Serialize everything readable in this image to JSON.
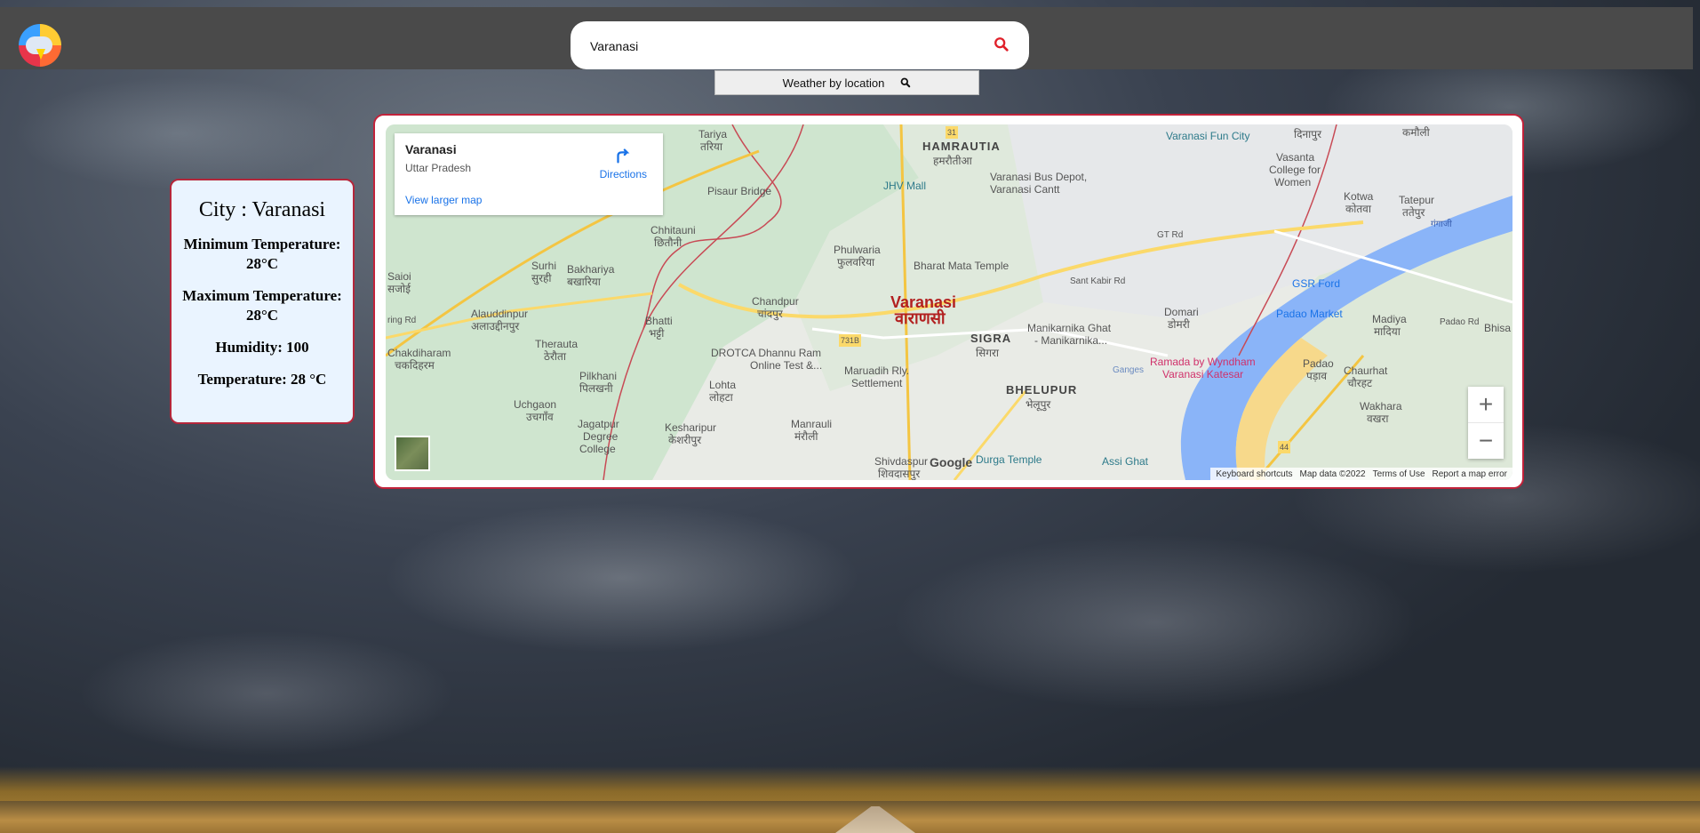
{
  "header": {
    "logo_icon": "weather-logo-icon",
    "search_value": "Varanasi",
    "search_icon": "search-icon",
    "location_button_label": "Weather by location"
  },
  "weather_card": {
    "city_line": "City : Varanasi",
    "min_temp_label": "Minimum Temperature:",
    "min_temp_value": "28°C",
    "max_temp_label": "Maximum Temperature:",
    "max_temp_value": "28°C",
    "humidity_line": "Humidity: 100",
    "temperature_line": "Temperature: 28 °C"
  },
  "map": {
    "place_name": "Varanasi",
    "place_region": "Uttar Pradesh",
    "directions_label": "Directions",
    "larger_map_link": "View larger map",
    "zoom_in": "+",
    "zoom_out": "−",
    "google_logo": "Google",
    "footer": [
      "Keyboard shortcuts",
      "Map data ©2022",
      "Terms of Use",
      "Report a map error"
    ],
    "labels": {
      "varanasi_en": "Varanasi",
      "varanasi_hi": "वाराणसी",
      "hamrautia": "HAMRAUTIA",
      "hamrautia_hi": "हमरौतीआ",
      "sigra": "SIGRA",
      "sigra_hi": "सिगरा",
      "bhelupur": "BHELUPUR",
      "bhelupur_hi": "भेलूपुर",
      "jhv_mall": "JHV Mall",
      "bus_depot": "Varanasi Bus Depot,",
      "bus_depot2": "Varanasi Cantt",
      "fun_city": "Varanasi Fun City",
      "bharat_mata": "Bharat Mata Temple",
      "pisaur": "Pisaur Bridge",
      "chandpur": "Chandpur",
      "chandpur_hi": "चांदपुर",
      "chhitauni": "Chhitauni",
      "chhitauni_hi": "छितौनी",
      "phulwaria": "Phulwaria",
      "phulwaria_hi": "फुलवरिया",
      "surhi": "Surhi",
      "surhi_hi": "सुरही",
      "bakhariya": "Bakhariya",
      "bakhariya_hi": "बखारिया",
      "saioi": "Saioi",
      "saioi_hi": "सजोई",
      "alauddinpur": "Alauddinpur",
      "alauddinpur_hi": "अलाउद्दीनपुर",
      "bhatti": "Bhatti",
      "bhatti_hi": "भट्टी",
      "therauta": "Therauta",
      "therauta_hi": "ठेरौता",
      "chakdiharam": "Chakdiharam",
      "chakdiharam_hi": "चकदिहरम",
      "pilkhani": "Pilkhani",
      "pilkhani_hi": "पिलखनी",
      "uchgaon": "Uchgaon",
      "uchgaon_hi": "उचगाँव",
      "lohta": "Lohta",
      "lohta_hi": "लोहटा",
      "dhannu": "DROTCA Dhannu Ram",
      "dhannu2": "Online Test &...",
      "maruadih": "Maruadih Rly.",
      "maruadih2": "Settlement",
      "manrauli": "Manrauli",
      "manrauli_hi": "मंरौली",
      "keshripur": "Kesharipur",
      "keshripur_hi": "केशरीपुर",
      "jagatpur": "Jagatpur",
      "jagatpur2": "Degree",
      "jagatpur3": "College",
      "shivdaspur": "Shivdaspur",
      "shivdaspur_hi": "शिवदासपुर",
      "durga": "Durga Temple",
      "assi": "Assi Ghat",
      "manikarnika": "Manikarnika Ghat",
      "manikarnika2": "- Manikarnika...",
      "ramada": "Ramada by Wyndham",
      "ramada2": "Varanasi Katesar",
      "domari": "Domari",
      "domari_hi": "डोमरी",
      "padao_market": "Padao Market",
      "padao": "Padao",
      "padao_hi": "पड़ाव",
      "gsr_ford": "GSR Ford",
      "madiya": "Madiya",
      "madiya_hi": "मादिया",
      "chaurhat": "Chaurhat",
      "chaurhat_hi": "चौरहट",
      "wakhara": "Wakhara",
      "wakhara_hi": "वखरा",
      "tatepur": "Tatepur",
      "tatepur_hi": "ततेपुर",
      "kotwa": "Kotwa",
      "kotwa_hi": "कोतवा",
      "vasanta": "Vasanta",
      "vasanta2": "College for",
      "vasanta3": "Women",
      "dinapur": "दिनापुर",
      "kamauli": "कमौली",
      "tariya": "Tariya",
      "tariya_hi": "तरिया",
      "bhisa": "Bhisa",
      "gt_rd": "GT Rd",
      "padao_rd": "Padao Rd",
      "sant_kabir": "Sant Kabir Rd",
      "ganges": "Ganges",
      "ganga_hi": "गंगाजी",
      "sarai_rd": "ring Rd",
      "r731b": "731B",
      "r31": "31",
      "r44": "44"
    }
  }
}
